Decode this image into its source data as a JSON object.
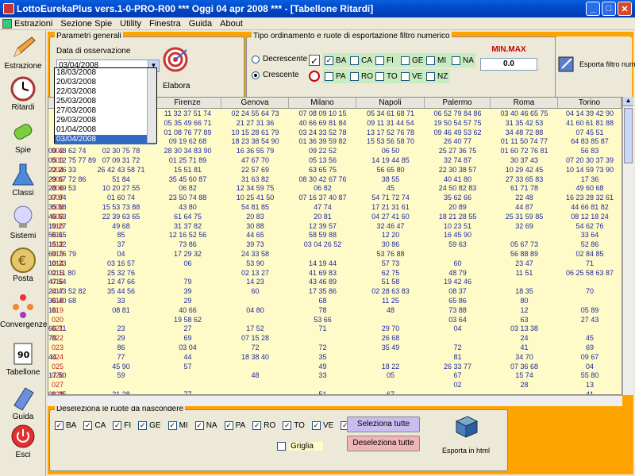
{
  "window": {
    "title": "LottoEurekaPlus vers.1-0-PRO-R00  ***  Oggi 04 apr 2008  ***  - [Tabellone Ritardi]"
  },
  "menu": [
    "Estrazioni",
    "Sezione Spie",
    "Utility",
    "Finestra",
    "Guida",
    "About"
  ],
  "sidebar": [
    "Estrazione",
    "Ritardi",
    "Spie",
    "Classi",
    "Sistemi",
    "Posta",
    "Convergenze",
    "Tabellone",
    "Guida",
    "Esci"
  ],
  "params": {
    "group_label": "Parametri generali",
    "date_label": "Data di osservazione",
    "date_value": "03/04/2008",
    "elabora": "Elabora",
    "date_options": [
      "18/03/2008",
      "20/03/2008",
      "22/03/2008",
      "25/03/2008",
      "27/03/2008",
      "29/03/2008",
      "01/04/2008",
      "03/04/2008"
    ]
  },
  "order": {
    "group_label": "Tipo ordinamento e ruote di esportazione filtro numerico",
    "decrescente": "Decrescente",
    "crescente": "Crescente",
    "row1": [
      {
        "l": "BA",
        "c": true
      },
      {
        "l": "CA",
        "c": false
      },
      {
        "l": "FI",
        "c": false
      },
      {
        "l": "GE",
        "c": false
      },
      {
        "l": "MI",
        "c": false
      },
      {
        "l": "NA",
        "c": false
      }
    ],
    "row2": [
      {
        "l": "PA",
        "c": false
      },
      {
        "l": "RO",
        "c": false
      },
      {
        "l": "TO",
        "c": false
      },
      {
        "l": "VE",
        "c": false
      },
      {
        "l": "NZ",
        "c": false
      }
    ],
    "minmax_label": "MIN.MAX",
    "minmax_value": "0.0",
    "export_label": "Esporta filtro numerico"
  },
  "table": {
    "headers": [
      "",
      "Cagliari",
      "Firenze",
      "Genova",
      "Milano",
      "Napoli",
      "Palermo",
      "Roma",
      "Torino"
    ],
    "rows": [
      [
        "",
        "02 20 35 41 68",
        "11 32 37 51 74",
        "02 24 55 64 73",
        "07 08 09 10 15",
        "05 34 61 68 71",
        "06 52 79 84 86",
        "03 40 46 65 75",
        "04 14 39 42 90"
      ],
      [
        "",
        "11 24 26 33 85",
        "05 35 49 66 71",
        "21 27 31 36",
        "40 66 69 81 84",
        "09 11 31 44 54",
        "19 50 54 57 75",
        "31 35 42 53",
        "41 60 61 81 88"
      ],
      [
        "",
        "10 47 70 84",
        "01 08 76 77 89",
        "10 15 28 61 79",
        "03 24 33 52 78",
        "13 17 52 76 78",
        "09 46 49 53 62",
        "34 48 72 88",
        "07 45 51"
      ],
      [
        "",
        "17 53 72 78",
        "09 19 62 68",
        "18 23 38 54 90",
        "01 36 39 59 82",
        "15 53 56 58 70",
        "26 40 77",
        "01 11 50 74 77",
        "64 83 85 87"
      ],
      [
        "002",
        "02 30 75 78",
        "28 30 34 83 90",
        "16 36 55 79",
        "09 22 52",
        "06 50",
        "25 27 36 75",
        "01 60 72 76 81",
        "56 83",
        "09 48 62 74"
      ],
      [
        "003",
        "07 09 31 72",
        "01 25 71 89",
        "47 67 70",
        "05 13 56",
        "14 19 44 85",
        "32 74 87",
        "30 37 43",
        "07 20 30 37 39",
        "05 12 75 77 89"
      ],
      [
        "004",
        "26 42 43 58 71",
        "15 51 81",
        "22 57 69",
        "63 65 75",
        "56 65 80",
        "22 30 38 57",
        "10 29 42 45",
        "10 14 59 73 90",
        "22 26 33"
      ],
      [
        "005",
        "51 84",
        "35 45 60 87",
        "31 63 82",
        "08 30 42 67 76",
        "38 55",
        "40 41 80",
        "27 33 65 83",
        "17 36",
        "29 67 72 86"
      ],
      [
        "006",
        "10 20 27 55",
        "06 82",
        "12 34 59 75",
        "06 82",
        "45",
        "24 50 82 83",
        "61 71 78",
        "49 60 68",
        "28 49 53"
      ],
      [
        "007",
        "01 60 74",
        "23 50 74 88",
        "10 25 41 50",
        "07 16 37 40 87",
        "54 71 72 74",
        "35 62 66",
        "22 48",
        "16 23 28 32 61",
        "37 84"
      ],
      [
        "008",
        "15 53 73 88",
        "43 80",
        "54 81 85",
        "47 74",
        "17 21 31 61",
        "20 89",
        "44 87",
        "44 66 81 82",
        "35 58"
      ],
      [
        "009",
        "22 39 63 65",
        "61 64 75",
        "20 83",
        "20 81",
        "04 27 41 60",
        "18 21 28 55",
        "25 31 59 85",
        "08 12 18 24",
        "46 63"
      ],
      [
        "010",
        "49 68",
        "31 37 82",
        "30 88",
        "12 39 57",
        "32 46 47",
        "10 23 51",
        "32 69",
        "54 62 76",
        "19 27"
      ],
      [
        "011",
        "85",
        "12 16 52 56",
        "44 65",
        "58 59 88",
        "12 20",
        "16 45 90",
        "",
        "33 64",
        "56 65"
      ],
      [
        "012",
        "37",
        "73 86",
        "39 73",
        "03 04 26 52",
        "30 86",
        "59 63",
        "05 67 73",
        "52 86",
        "15 32"
      ],
      [
        "013",
        "04",
        "17 29 32",
        "24 33 58",
        "",
        "53 76 88",
        "",
        "56 88 89",
        "02 84 85",
        "69 76 79"
      ],
      [
        "014",
        "03 16 57",
        "06",
        "53 90",
        "14 19 44",
        "57 73",
        "60",
        "23 47",
        "71",
        "10 23"
      ],
      [
        "015",
        "25 32 76",
        "",
        "02 13 27",
        "41 69 83",
        "62 75",
        "48 79",
        "11 51",
        "06 25 58 63 87",
        "02 11 80"
      ],
      [
        "016",
        "12 47 66",
        "79",
        "14 23",
        "43 46 89",
        "51 58",
        "19 42 46",
        "",
        "",
        "47 54"
      ],
      [
        "017",
        "35 44 56",
        "39",
        "60",
        "17 35 86",
        "02 28 63 83",
        "08 37",
        "18 35",
        "70",
        "24 43 52 82"
      ],
      [
        "018",
        "33",
        "29",
        "",
        "68",
        "11 25",
        "65 86",
        "80",
        "",
        "36 40 68"
      ],
      [
        "019",
        "08 81",
        "40 66",
        "04 80",
        "78",
        "48",
        "73 88",
        "12",
        "05 89",
        "16"
      ],
      [
        "020",
        "",
        "19 58 62",
        "",
        "53 66",
        "",
        "03 64",
        "63",
        "27 43",
        ""
      ],
      [
        "021",
        "23",
        "27",
        "17 52",
        "71",
        "29 70",
        "04",
        "03 13 38",
        "",
        "66 71"
      ],
      [
        "022",
        "29",
        "69",
        "07 15 28",
        "",
        "26 68",
        "",
        "24",
        "45",
        "78"
      ],
      [
        "023",
        "86",
        "03 04",
        "72",
        "72",
        "35 49",
        "72",
        "41",
        "69",
        ""
      ],
      [
        "024",
        "77",
        "44",
        "18 38 40",
        "35",
        "",
        "81",
        "34 70",
        "09 67",
        "44"
      ],
      [
        "025",
        "45 90",
        "57",
        "",
        "49",
        "18 22",
        "26 33 77",
        "07 36 68",
        "04",
        ""
      ],
      [
        "026",
        "59",
        "",
        "48",
        "33",
        "05",
        "67",
        "15 74",
        "55 80",
        "17 50"
      ],
      [
        "027",
        "",
        "",
        "",
        "",
        "",
        "02",
        "28",
        "13",
        ""
      ],
      [
        "028",
        "21 28",
        "77",
        "",
        "51",
        "67",
        "",
        "",
        "41",
        "06 25"
      ]
    ]
  },
  "hide": {
    "group_label": "Deseleziona le ruote da nascondere",
    "wheels": [
      {
        "l": "BA",
        "c": true
      },
      {
        "l": "CA",
        "c": true
      },
      {
        "l": "FI",
        "c": true
      },
      {
        "l": "GE",
        "c": true
      },
      {
        "l": "MI",
        "c": true
      },
      {
        "l": "NA",
        "c": true
      },
      {
        "l": "PA",
        "c": true
      },
      {
        "l": "RO",
        "c": true
      },
      {
        "l": "TO",
        "c": true
      },
      {
        "l": "VE",
        "c": true
      },
      {
        "l": "NAZ",
        "c": true
      }
    ],
    "griglia": "Griglia",
    "select_all": "Seleziona tutte",
    "deselect_all": "Deseleziona tutte",
    "export_html": "Esporta in html"
  },
  "colors": {
    "title_bar": "#0a5ee0",
    "accent_orange": "#ffa300",
    "table_bg": "#fffbc8",
    "cell_text": "#1c2a9e",
    "row_num": "#b22222"
  }
}
